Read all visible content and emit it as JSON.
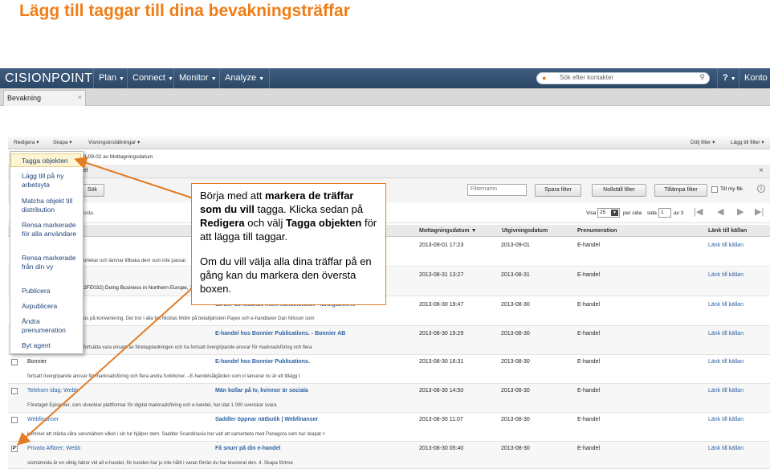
{
  "heading": "Lägg till taggar till dina bevakningsträffar",
  "app": {
    "logo": "CISIONPOINT",
    "nav": [
      "Plan",
      "Connect",
      "Monitor",
      "Analyze"
    ],
    "search_placeholder": "Sök efter kontakter",
    "help": "?",
    "account": "Konto"
  },
  "tab": {
    "label": "Bevakning",
    "close": "×"
  },
  "toolbar": {
    "items": [
      "Redigera",
      "Skapa",
      "Visningsinställningar"
    ],
    "right": [
      "Dölj filter",
      "Lägg till filter"
    ]
  },
  "dropdown": {
    "items": [
      "Tagga objekten",
      "Lägg till på ny arbetsyta",
      "Matcha objekt till distribution",
      "Rensa markerade för alla användare",
      "Rensa markerade från din vy",
      "Publicera",
      "Avpublicera",
      "Ändra prenumeration",
      "Byt agent"
    ]
  },
  "filter_line": {
    "date_text": "3-09-02 av Mottagningsdatum",
    "label": "el",
    "close": "×"
  },
  "search": {
    "sok_button": "Sök",
    "filtername_placeholder": "Filternamn",
    "save_filter": "Spara filter",
    "reset_filter": "Nollställ filter",
    "apply_filter": "Tillämpa filter",
    "my_flik": "Till my flik",
    "info": "i"
  },
  "pager": {
    "visa_label": "Visa",
    "per_page": "25",
    "per_sida": "per sida",
    "sida_label": "sida",
    "page": "1",
    "of_pages": "av 3",
    "hits": "sida"
  },
  "columns": {
    "received": "Mottagningsdatum",
    "published": "Utgivningsdatum",
    "subscription": "Prenumeration",
    "link": "Länk till källan"
  },
  "rows": [
    {
      "source": "",
      "title": "",
      "received": "2013-09-01 17:23",
      "published": "2013-09-01",
      "sub": "E-handel",
      "link": "Länk till källan",
      "snippet": "orlekar och lämnar tillbaka dem som inte passar.",
      "checked": false
    },
    {
      "source": "(2FE032) Doing Business in Northern Europe, 2...",
      "title": "",
      "received": "2013-08-31 13:27",
      "published": "2013-08-31",
      "sub": "E-handel",
      "link": "Länk till källan",
      "snippet": "",
      "checked": false
    },
    {
      "source": "",
      "title": "Så blir du ledande inom handelsfältet - färdigtänkt ...",
      "received": "2013-08-30 19:47",
      "published": "2013-08-30",
      "sub": "E-handel",
      "link": "Länk till källan",
      "snippet": "us på konvertering. Det tror i alla fall Nicklas Molin på betaltjänsten Payex och e-handlaren Dan Nilsson som",
      "checked": false
    },
    {
      "source": "",
      "title": "E-handel hos Bonnier Publications. - Bonnier AB",
      "received": "2013-08-30 19:29",
      "published": "2013-08-30",
      "sub": "E-handel",
      "link": "Länk till källan",
      "snippet": "fortsätta vara ensam av företagsledningen och ha fortsatt övergripande ansvar för marknadsföring och flera",
      "checked": false
    },
    {
      "source": "Bonnier",
      "title": "E-handel hos Bonnier Publications.",
      "received": "2013-08-30 16:31",
      "published": "2013-08-30",
      "sub": "E-handel",
      "link": "Länk till källan",
      "snippet": "fortsatt övergripande ansvar för marknadsföring och flera andra funktioner. –E-handelsålgården som vi lanserar nu är ett tillägg t",
      "checked": false
    },
    {
      "source": "Telekom idag; Webb",
      "title": "Män kollar på tv, kvinnor är sociala",
      "received": "2013-08-30 14:50",
      "published": "2013-08-30",
      "sub": "E-handel",
      "link": "Länk till källan",
      "snippet": "Företaget Episerver, som utvecklar plattformar för digital marknadsföring och e-handel, har idat 1 000 svenskar svara",
      "checked": false
    },
    {
      "source": "Webfinanser",
      "title": "Saddler öppnar nätbutik | Webfinanser",
      "received": "2013-08-30 11:07",
      "published": "2013-08-30",
      "sub": "E-handel",
      "link": "Länk till källan",
      "snippet": "kommer att stärka våra varumärken vilket i sin tur hjälper dem. Saddler Scandinavia har valt att samarbeta med Panagora som har skapat <",
      "checked": false
    },
    {
      "source": "Privata Affärer; Webb",
      "title": "Få snurr på din e-handel",
      "received": "2013-08-30 05:40",
      "published": "2013-08-30",
      "sub": "E-handel",
      "link": "Länk till källan",
      "snippet": "sistnämnda är en viktig faktor vid all e-handel, för kunden har ju inte hållt i varan förrän du har levererat den. 4. Skapa förtroe",
      "checked": true
    }
  ],
  "callout": {
    "p1_pre": "Börja med att ",
    "p1_b1": "markera de träffar som du vill",
    "p1_mid": " tagga. Klicka sedan på ",
    "p1_b2": "Redigera",
    "p1_mid2": " och välj ",
    "p1_b3": "Tagga objekten",
    "p1_post": " för att lägga till taggar.",
    "p2": "Om du vill välja alla dina träffar på en gång kan du markera den översta boxen."
  },
  "colors": {
    "heading": "#f07d16",
    "topbar": "#34506f",
    "arrow": "#e27b25",
    "link": "#2c63a5"
  }
}
